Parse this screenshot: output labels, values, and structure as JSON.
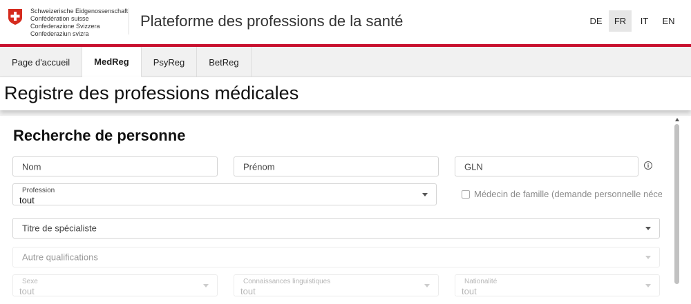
{
  "header": {
    "confederation_lines": [
      "Schweizerische Eidgenossenschaft",
      "Confédération suisse",
      "Confederazione Svizzera",
      "Confederaziun svizra"
    ],
    "site_title": "Plateforme des professions de la santé",
    "languages": [
      {
        "label": "DE",
        "active": false
      },
      {
        "label": "FR",
        "active": true
      },
      {
        "label": "IT",
        "active": false
      },
      {
        "label": "EN",
        "active": false
      }
    ],
    "accent_color": "#c8102e"
  },
  "tabs": [
    {
      "label": "Page d'accueil",
      "active": false
    },
    {
      "label": "MedReg",
      "active": true
    },
    {
      "label": "PsyReg",
      "active": false
    },
    {
      "label": "BetReg",
      "active": false
    }
  ],
  "page_title": "Registre des professions médicales",
  "search": {
    "section_title": "Recherche de personne",
    "nom_placeholder": "Nom",
    "prenom_placeholder": "Prénom",
    "gln_placeholder": "GLN",
    "info_icon": "info-icon",
    "profession": {
      "label": "Profession",
      "value": "tout"
    },
    "medecin_famille_label": "Médecin de famille (demande personnelle nécessaire)",
    "titre_specialiste_placeholder": "Titre de spécialiste",
    "autre_qualifications_placeholder": "Autre qualifications",
    "sexe": {
      "label": "Sexe",
      "value": "tout"
    },
    "connaissances": {
      "label": "Connaissances linguistiques",
      "value": "tout"
    },
    "nationalite": {
      "label": "Nationalité",
      "value": "tout"
    }
  }
}
